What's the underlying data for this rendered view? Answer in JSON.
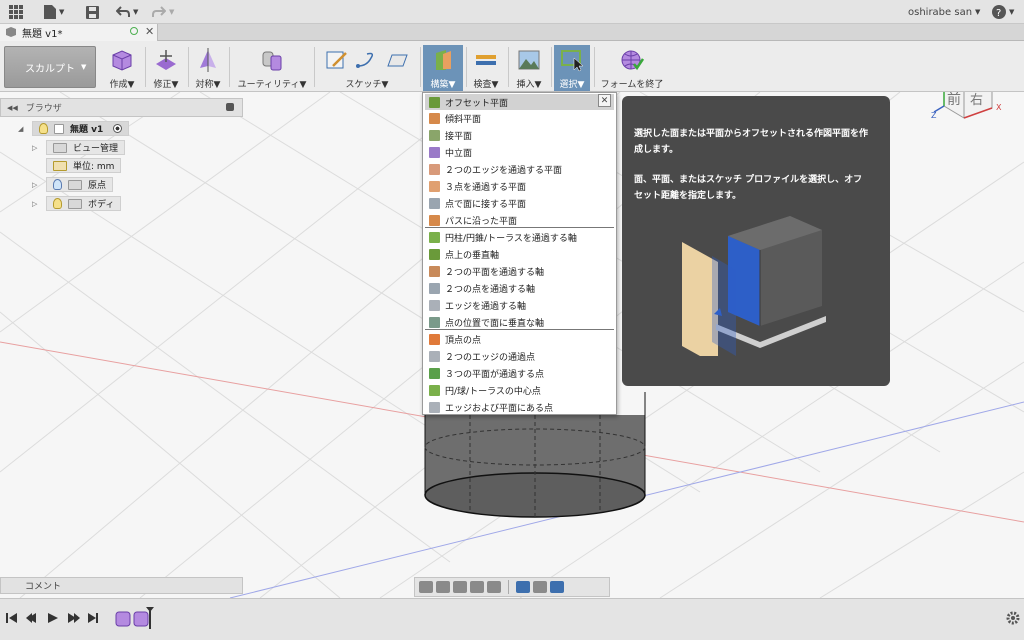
{
  "app": {
    "user": "oshirabe san",
    "help_icon": "question-icon"
  },
  "tab": {
    "title": "無題 v1*"
  },
  "ribbon": {
    "workspace": "スカルプト",
    "groups": [
      {
        "id": "create",
        "label": "作成▼"
      },
      {
        "id": "modify",
        "label": "修正▼"
      },
      {
        "id": "symmetry",
        "label": "対称▼"
      },
      {
        "id": "utility",
        "label": "ユーティリティ▼"
      },
      {
        "id": "sketch",
        "label": "スケッチ▼"
      },
      {
        "id": "construct",
        "label": "構築▼"
      },
      {
        "id": "inspect",
        "label": "検査▼"
      },
      {
        "id": "insert",
        "label": "挿入▼"
      },
      {
        "id": "select",
        "label": "選択▼"
      },
      {
        "id": "finish",
        "label": "フォームを終了"
      }
    ]
  },
  "browser": {
    "title": "ブラウザ",
    "root": "無題 v1",
    "items": [
      "ビュー管理",
      "単位: mm",
      "原点",
      "ボディ"
    ]
  },
  "comment": {
    "label": "コメント"
  },
  "view_cube": {
    "front": "前",
    "right": "右",
    "axis_x": "X",
    "axis_y": "Y",
    "axis_z": "Z"
  },
  "menu": {
    "items": [
      {
        "label": "オフセット平面",
        "color": "#6a9a3a"
      },
      {
        "label": "傾斜平面",
        "color": "#d6894a"
      },
      {
        "label": "接平面",
        "color": "#8aa56a"
      },
      {
        "label": "中立面",
        "color": "#9a7ac8"
      },
      {
        "label": "２つのエッジを通過する平面",
        "color": "#d89a7a"
      },
      {
        "label": "３点を通過する平面",
        "color": "#e0a070"
      },
      {
        "label": "点で面に接する平面",
        "color": "#9aa5b0"
      },
      {
        "label": "パスに沿った平面",
        "color": "#d6894a"
      },
      {
        "label": "円柱/円錐/トーラスを通過する軸",
        "color": "#7ab04a"
      },
      {
        "label": "点上の垂直軸",
        "color": "#6a9a3a"
      },
      {
        "label": "２つの平面を通過する軸",
        "color": "#c88a5a"
      },
      {
        "label": "２つの点を通過する軸",
        "color": "#9aa5b0"
      },
      {
        "label": "エッジを通過する軸",
        "color": "#aab0b8"
      },
      {
        "label": "点の位置で面に垂直な軸",
        "color": "#7a9a8a"
      },
      {
        "label": "頂点の点",
        "color": "#e07a3a"
      },
      {
        "label": "２つのエッジの通過点",
        "color": "#aab0b8"
      },
      {
        "label": "３つの平面が通過する点",
        "color": "#5aa04a"
      },
      {
        "label": "円/球/トーラスの中心点",
        "color": "#7ab04a"
      },
      {
        "label": "エッジおよび平面にある点",
        "color": "#aab0b8"
      }
    ]
  },
  "tooltip": {
    "line1": "選択した面または平面からオフセットされる作図平面を作成します。",
    "line2": "面、平面、またはスケッチ プロファイルを選択し、オフセット距離を指定します。"
  }
}
